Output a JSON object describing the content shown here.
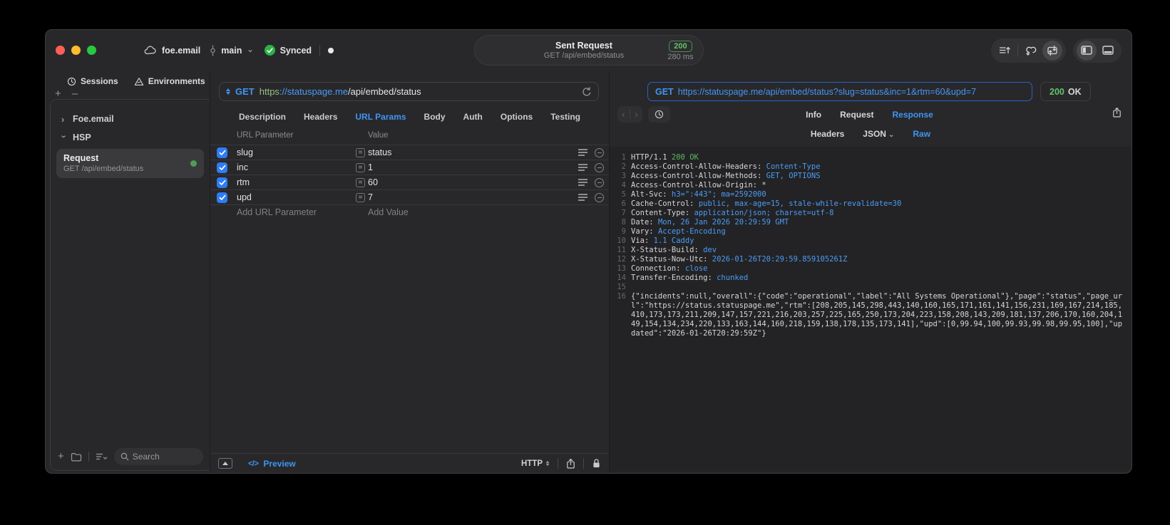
{
  "titlebar": {
    "project": "foe.email",
    "branch": "main",
    "sync_status": "Synced",
    "title": "Sent Request",
    "subtitle": "GET /api/embed/status",
    "status_code": "200",
    "duration": "280 ms"
  },
  "sidebar": {
    "tabs": [
      {
        "label": "Sessions",
        "icon": "history-icon"
      },
      {
        "label": "Environments",
        "icon": "environments-icon"
      }
    ],
    "tree": [
      {
        "label": "Foe.email",
        "expanded": false
      },
      {
        "label": "HSP",
        "expanded": true
      }
    ],
    "request_item": {
      "title": "Request",
      "subtitle": "GET /api/embed/status",
      "status_dot_color": "#4e9e58"
    },
    "search_placeholder": "Search"
  },
  "request_panel": {
    "method": "GET",
    "url_scheme": "https",
    "url_host": "://statuspage.me",
    "url_path": "/api/embed/status",
    "tabs": [
      "Description",
      "Headers",
      "URL Params",
      "Body",
      "Auth",
      "Options",
      "Testing"
    ],
    "active_tab": "URL Params",
    "params": {
      "columns": [
        "URL Parameter",
        "Value"
      ],
      "operator": "=",
      "rows": [
        {
          "enabled": true,
          "name": "slug",
          "value": "status"
        },
        {
          "enabled": true,
          "name": "inc",
          "value": "1"
        },
        {
          "enabled": true,
          "name": "rtm",
          "value": "60"
        },
        {
          "enabled": true,
          "name": "upd",
          "value": "7"
        }
      ],
      "add_name_placeholder": "Add URL Parameter",
      "add_value_placeholder": "Add Value"
    },
    "bottom": {
      "preview_label": "Preview",
      "code_glyph": "</>",
      "protocol": "HTTP"
    }
  },
  "response_panel": {
    "method": "GET",
    "url": "https://statuspage.me/api/embed/status?slug=status&inc=1&rtm=60&upd=7",
    "status_code": "200",
    "status_text": "OK",
    "tabs": [
      "Info",
      "Request",
      "Response"
    ],
    "active_tab": "Response",
    "subtabs": [
      "Headers",
      "JSON",
      "Raw"
    ],
    "active_subtab": "Raw",
    "lines": [
      {
        "n": 1,
        "parts": [
          {
            "t": "HTTP/1.1 ",
            "c": "plain"
          },
          {
            "t": "200 OK",
            "c": "green"
          }
        ]
      },
      {
        "n": 2,
        "parts": [
          {
            "t": "Access-Control-Allow-Headers: ",
            "c": "plain"
          },
          {
            "t": "Content-Type",
            "c": "blue"
          }
        ]
      },
      {
        "n": 3,
        "parts": [
          {
            "t": "Access-Control-Allow-Methods: ",
            "c": "plain"
          },
          {
            "t": "GET, OPTIONS",
            "c": "blue"
          }
        ]
      },
      {
        "n": 4,
        "parts": [
          {
            "t": "Access-Control-Allow-Origin: ",
            "c": "plain"
          },
          {
            "t": "*",
            "c": "plain"
          }
        ]
      },
      {
        "n": 5,
        "parts": [
          {
            "t": "Alt-Svc: ",
            "c": "plain"
          },
          {
            "t": "h3=\":443\"; ma=2592000",
            "c": "blue"
          }
        ]
      },
      {
        "n": 6,
        "parts": [
          {
            "t": "Cache-Control: ",
            "c": "plain"
          },
          {
            "t": "public, max-age=15, stale-while-revalidate=30",
            "c": "blue"
          }
        ]
      },
      {
        "n": 7,
        "parts": [
          {
            "t": "Content-Type: ",
            "c": "plain"
          },
          {
            "t": "application/json; charset=utf-8",
            "c": "blue"
          }
        ]
      },
      {
        "n": 8,
        "parts": [
          {
            "t": "Date: ",
            "c": "plain"
          },
          {
            "t": "Mon, 26 Jan 2026 20:29:59 GMT",
            "c": "blue"
          }
        ]
      },
      {
        "n": 9,
        "parts": [
          {
            "t": "Vary: ",
            "c": "plain"
          },
          {
            "t": "Accept-Encoding",
            "c": "blue"
          }
        ]
      },
      {
        "n": 10,
        "parts": [
          {
            "t": "Via: ",
            "c": "plain"
          },
          {
            "t": "1.1 Caddy",
            "c": "blue"
          }
        ]
      },
      {
        "n": 11,
        "parts": [
          {
            "t": "X-Status-Build: ",
            "c": "plain"
          },
          {
            "t": "dev",
            "c": "blue"
          }
        ]
      },
      {
        "n": 12,
        "parts": [
          {
            "t": "X-Status-Now-Utc: ",
            "c": "plain"
          },
          {
            "t": "2026-01-26T20:29:59.859105261Z",
            "c": "blue"
          }
        ]
      },
      {
        "n": 13,
        "parts": [
          {
            "t": "Connection: ",
            "c": "plain"
          },
          {
            "t": "close",
            "c": "blue"
          }
        ]
      },
      {
        "n": 14,
        "parts": [
          {
            "t": "Transfer-Encoding: ",
            "c": "plain"
          },
          {
            "t": "chunked",
            "c": "blue"
          }
        ]
      },
      {
        "n": 15,
        "parts": []
      },
      {
        "n": 16,
        "parts": [
          {
            "t": "{\"incidents\":null,\"overall\":{\"code\":\"operational\",\"label\":\"All Systems Operational\"},\"page\":\"status\",\"page_url\":\"https://status.statuspage.me\",\"rtm\":[208,205,145,298,443,140,160,165,171,161,141,156,231,169,167,214,185,410,173,173,211,209,147,157,221,216,203,257,225,165,250,173,204,223,158,208,143,209,181,137,206,170,160,204,149,154,134,234,220,133,163,144,160,218,159,138,178,135,173,141],\"upd\":[0,99.94,100,99.93,99.98,99.95,100],\"updated\":\"2026-01-26T20:29:59Z\"}",
            "c": "plain"
          }
        ]
      }
    ]
  },
  "icons": {
    "cloud": "cloud shape",
    "branch": "git-commit",
    "chevron_down": "⌄",
    "synced_check": "✓",
    "history": "clock",
    "environments": "triangle",
    "equals": "=",
    "search": "magnifier",
    "refresh": "circular-arrow",
    "lock": "padlock",
    "share": "box-up-arrow"
  },
  "colors": {
    "accent_blue": "#3f95f5",
    "value_blue": "#4c9bf5",
    "status_green": "#67c16a",
    "response_green": "#5cb75f",
    "scheme_green": "#9dbf87",
    "window_bg": "#28282a",
    "editor_bg": "#232325",
    "selected_item_bg": "#3a3a3c",
    "checkbox_blue": "#2e7cf6",
    "traffic_red": "#ff5f57",
    "traffic_yellow": "#febc2e",
    "traffic_green": "#28c840"
  }
}
